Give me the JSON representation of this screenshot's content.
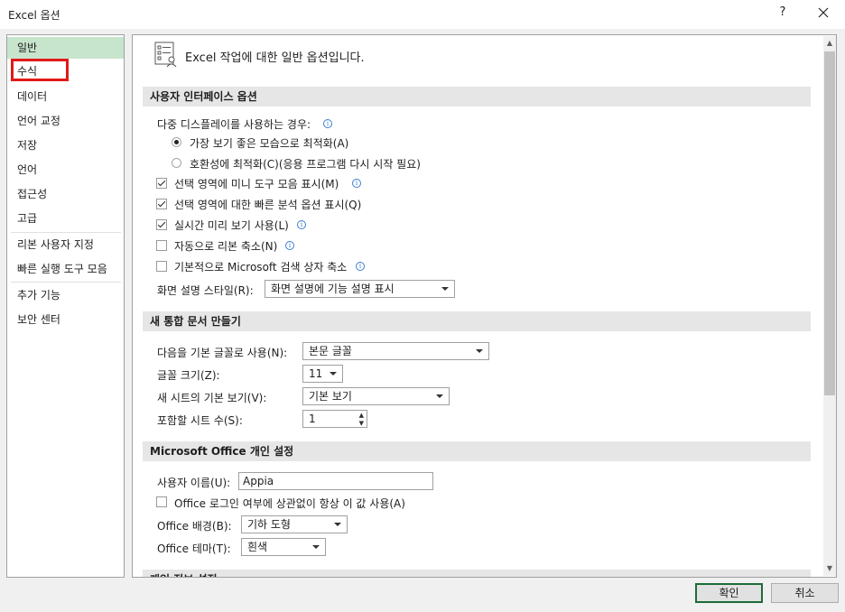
{
  "window": {
    "title": "Excel 옵션",
    "help_label": "?"
  },
  "nav": {
    "items": [
      "일반",
      "수식",
      "데이터",
      "언어 교정",
      "저장",
      "언어",
      "접근성",
      "고급",
      "리본 사용자 지정",
      "빠른 실행 도구 모음",
      "추가 기능",
      "보안 센터"
    ],
    "selected": "일반"
  },
  "header": {
    "title": "Excel 작업에 대한 일반 옵션입니다."
  },
  "sections": {
    "ui": {
      "title": "사용자 인터페이스 옵션",
      "multi_display_label": "다중 디스플레이를 사용하는 경우:",
      "radio_best": "가장 보기 좋은 모습으로 최적화(A)",
      "radio_compat": "호환성에 최적화(C)(응용 프로그램 다시 시작 필요)",
      "check_mini_toolbar": "선택 영역에 미니 도구 모음 표시(M)",
      "check_quick_analysis": "선택 영역에 대한 빠른 분석 옵션 표시(Q)",
      "check_live_preview": "실시간 미리 보기 사용(L)",
      "check_collapse_ribbon": "자동으로 리본 축소(N)",
      "check_collapse_search": "기본적으로 Microsoft 검색 상자 축소",
      "screentip_label": "화면 설명 스타일(R):",
      "screentip_value": "화면 설명에 기능 설명 표시"
    },
    "new_workbook": {
      "title": "새 통합 문서 만들기",
      "font_label": "다음을 기본 글꼴로 사용(N):",
      "font_value": "본문 글꼴",
      "size_label": "글꼴 크기(Z):",
      "size_value": "11",
      "view_label": "새 시트의 기본 보기(V):",
      "view_value": "기본 보기",
      "sheets_label": "포함할 시트 수(S):",
      "sheets_value": "1"
    },
    "personalize": {
      "title": "Microsoft Office 개인 설정",
      "username_label": "사용자 이름(U):",
      "username_value": "Appia",
      "always_use_label": "Office 로그인 여부에 상관없이 항상 이 값 사용(A)",
      "background_label": "Office 배경(B):",
      "background_value": "기하 도형",
      "theme_label": "Office 테마(T):",
      "theme_value": "흰색"
    },
    "privacy": {
      "title": "개인 정보 설정"
    }
  },
  "buttons": {
    "ok": "확인",
    "cancel": "취소"
  },
  "colors": {
    "selected_nav": "#c7e4cc",
    "highlight_box": "#e01a1a",
    "ok_border": "#1e6b3a"
  }
}
